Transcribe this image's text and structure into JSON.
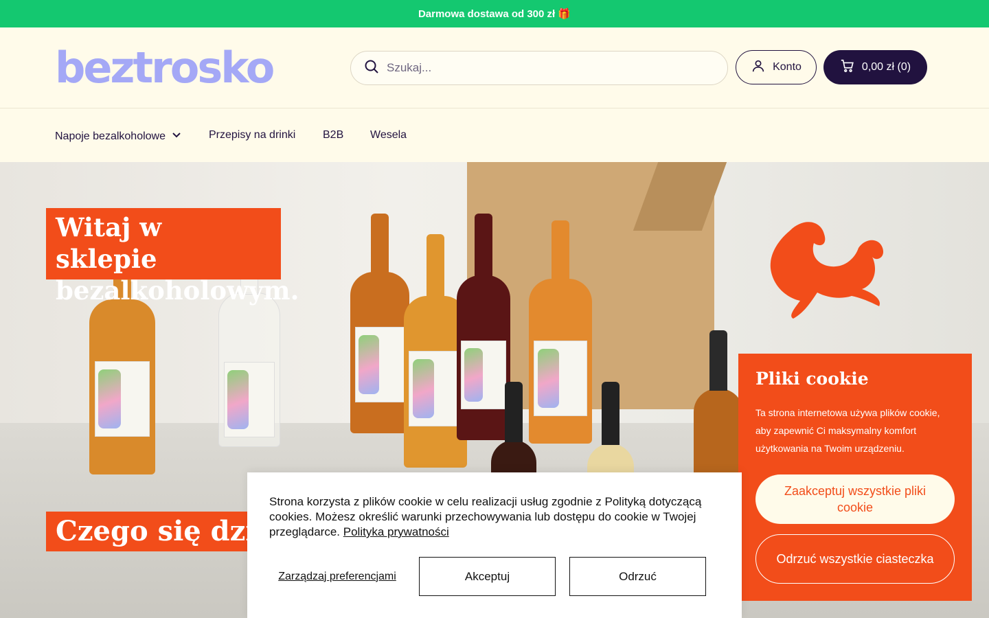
{
  "announcement": {
    "text": "Darmowa dostawa od 300 zł 🎁"
  },
  "header": {
    "logo": "beztrosko",
    "search_placeholder": "Szukaj...",
    "account_label": "Konto",
    "cart_label": "0,00 zł (0)"
  },
  "nav": {
    "items": [
      {
        "label": "Napoje bezalkoholowe"
      },
      {
        "label": "Przepisy na drinki"
      },
      {
        "label": "B2B"
      },
      {
        "label": "Wesela"
      }
    ]
  },
  "hero": {
    "title_line1": "Witaj w sklepie",
    "title_line2": "bezalkoholowym.",
    "subtitle": "Czego się dziś na"
  },
  "cookie_panel": {
    "title": "Pliki cookie",
    "text": "Ta strona internetowa używa plików cookie, aby zapewnić Ci maksymalny komfort użytkowania na Twoim urządzeniu.",
    "accept_all": "Zaakceptuj wszystkie pliki cookie",
    "reject_all": "Odrzuć wszystkie ciasteczka"
  },
  "cookie_banner": {
    "text": "Strona korzysta z plików cookie w celu realizacji usług zgodnie z Polityką dotyczącą cookies. Możesz określić warunki przechowywania lub dostępu do cookie w Twojej przeglądarce.",
    "privacy_link": "Polityka prywatności",
    "manage": "Zarządzaj preferencjami",
    "accept": "Akceptuj",
    "reject": "Odrzuć"
  },
  "colors": {
    "announcement_bg": "#14c870",
    "brand_orange": "#f24d1a",
    "dark_navy": "#21123f",
    "logo_lavender": "#a4a8f6",
    "cream": "#fffbea"
  }
}
